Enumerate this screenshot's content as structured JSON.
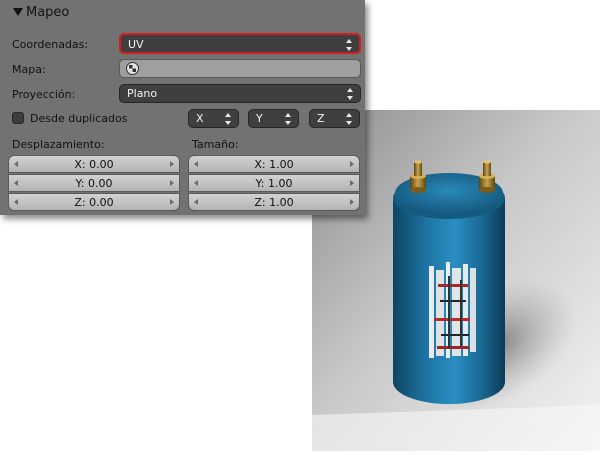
{
  "panel": {
    "title": "Mapeo",
    "coordenadas": {
      "label": "Coordenadas:",
      "value": "UV"
    },
    "mapa": {
      "label": "Mapa:"
    },
    "proyeccion": {
      "label": "Proyección:",
      "value": "Plano"
    },
    "desde_duplicados": {
      "label": "Desde duplicados",
      "checked": false
    },
    "axes": [
      "X",
      "Y",
      "Z"
    ],
    "desplazamiento": {
      "label": "Desplazamiento:",
      "x": "X: 0.00",
      "y": "Y: 0.00",
      "z": "Z: 0.00"
    },
    "tamano": {
      "label": "Tamaño:",
      "x": "X: 1.00",
      "y": "Y: 1.00",
      "z": "Z: 1.00"
    }
  },
  "colors": {
    "highlight": "#d41d1d",
    "panel_bg": "#727272",
    "dropdown_bg": "#3f3f3f",
    "capacitor_body": "#1f6f9a",
    "terminals": "#9a7a2a"
  }
}
